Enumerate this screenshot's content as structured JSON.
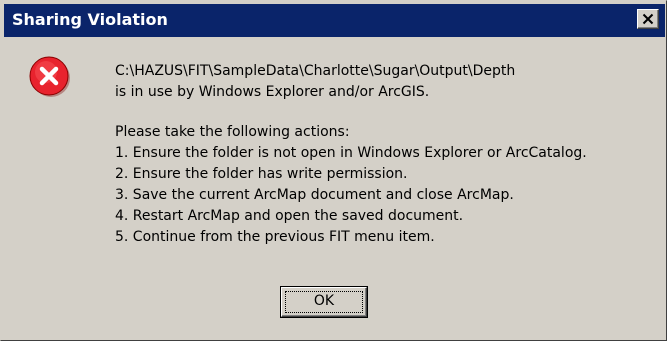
{
  "dialog": {
    "title": "Sharing Violation",
    "close_label": "×",
    "icon": "error-icon",
    "lines": [
      "C:\\HAZUS\\FIT\\SampleData\\Charlotte\\Sugar\\Output\\Depth",
      "is in use by Windows Explorer and/or ArcGIS."
    ],
    "instructions_heading": "Please take the following actions:",
    "steps": [
      "1. Ensure the folder is not open in Windows Explorer or ArcCatalog.",
      "2. Ensure the folder has write permission.",
      "3. Save the current ArcMap document and close ArcMap.",
      "4. Restart ArcMap and open the saved document.",
      "5. Continue from the previous FIT menu item."
    ],
    "ok_label": "OK"
  },
  "colors": {
    "titlebar": "#0a246a",
    "face": "#d4d0c8",
    "error_red": "#e8232e"
  }
}
